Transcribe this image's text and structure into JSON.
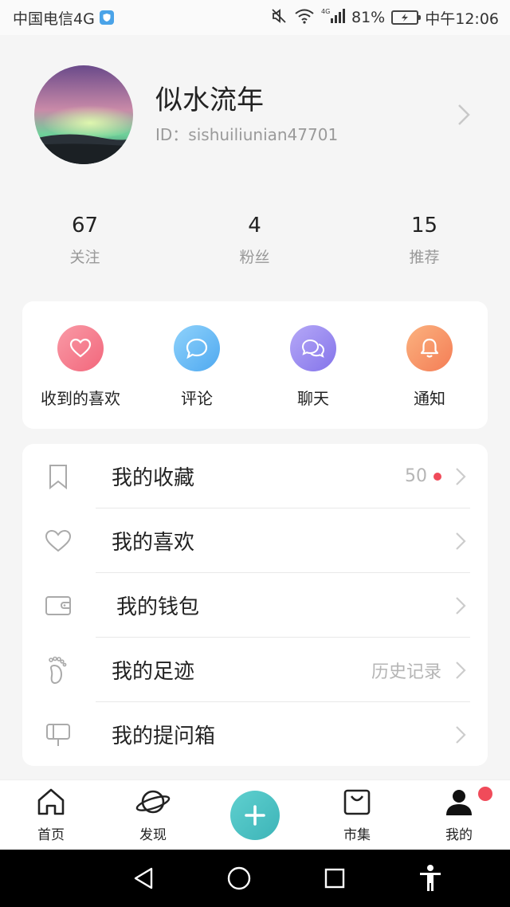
{
  "status_bar": {
    "carrier": "中国电信4G",
    "network": "4G",
    "battery": "81%",
    "time": "中午12:06",
    "icons": [
      "shield-icon",
      "mute-icon",
      "wifi-icon",
      "signal-icon",
      "battery-icon"
    ]
  },
  "profile": {
    "name": "似水流年",
    "id": "ID：sishuiliunian47701"
  },
  "stats": [
    {
      "value": "67",
      "label": "关注"
    },
    {
      "value": "4",
      "label": "粉丝"
    },
    {
      "value": "15",
      "label": "推荐"
    }
  ],
  "actions": [
    {
      "label": "收到的喜欢",
      "icon": "heart-icon",
      "color": "#f56f82"
    },
    {
      "label": "评论",
      "icon": "comment-icon",
      "color": "#5fb8f3"
    },
    {
      "label": "聊天",
      "icon": "chat-icon",
      "color": "#9b8cf0"
    },
    {
      "label": "通知",
      "icon": "bell-icon",
      "color": "#f7935a"
    }
  ],
  "menu": [
    {
      "label": "我的收藏",
      "icon": "bookmark-icon",
      "extra": "50",
      "dot": true
    },
    {
      "label": "我的喜欢",
      "icon": "heart-outline-icon",
      "extra": ""
    },
    {
      "label": "我的钱包",
      "icon": "wallet-icon",
      "extra": ""
    },
    {
      "label": "我的足迹",
      "icon": "footprint-icon",
      "extra": "历史记录"
    },
    {
      "label": "我的提问箱",
      "icon": "question-box-icon",
      "extra": ""
    }
  ],
  "tabbar": [
    {
      "label": "首页",
      "icon": "home-icon"
    },
    {
      "label": "发现",
      "icon": "planet-icon"
    },
    {
      "label": "",
      "icon": "plus-icon"
    },
    {
      "label": "市集",
      "icon": "shopping-bag-icon"
    },
    {
      "label": "我的",
      "icon": "user-icon",
      "badge": true
    }
  ],
  "colors": {
    "accent_teal": "#3db4b8",
    "badge_red": "#f04b5a",
    "background": "#f5f5f5"
  }
}
